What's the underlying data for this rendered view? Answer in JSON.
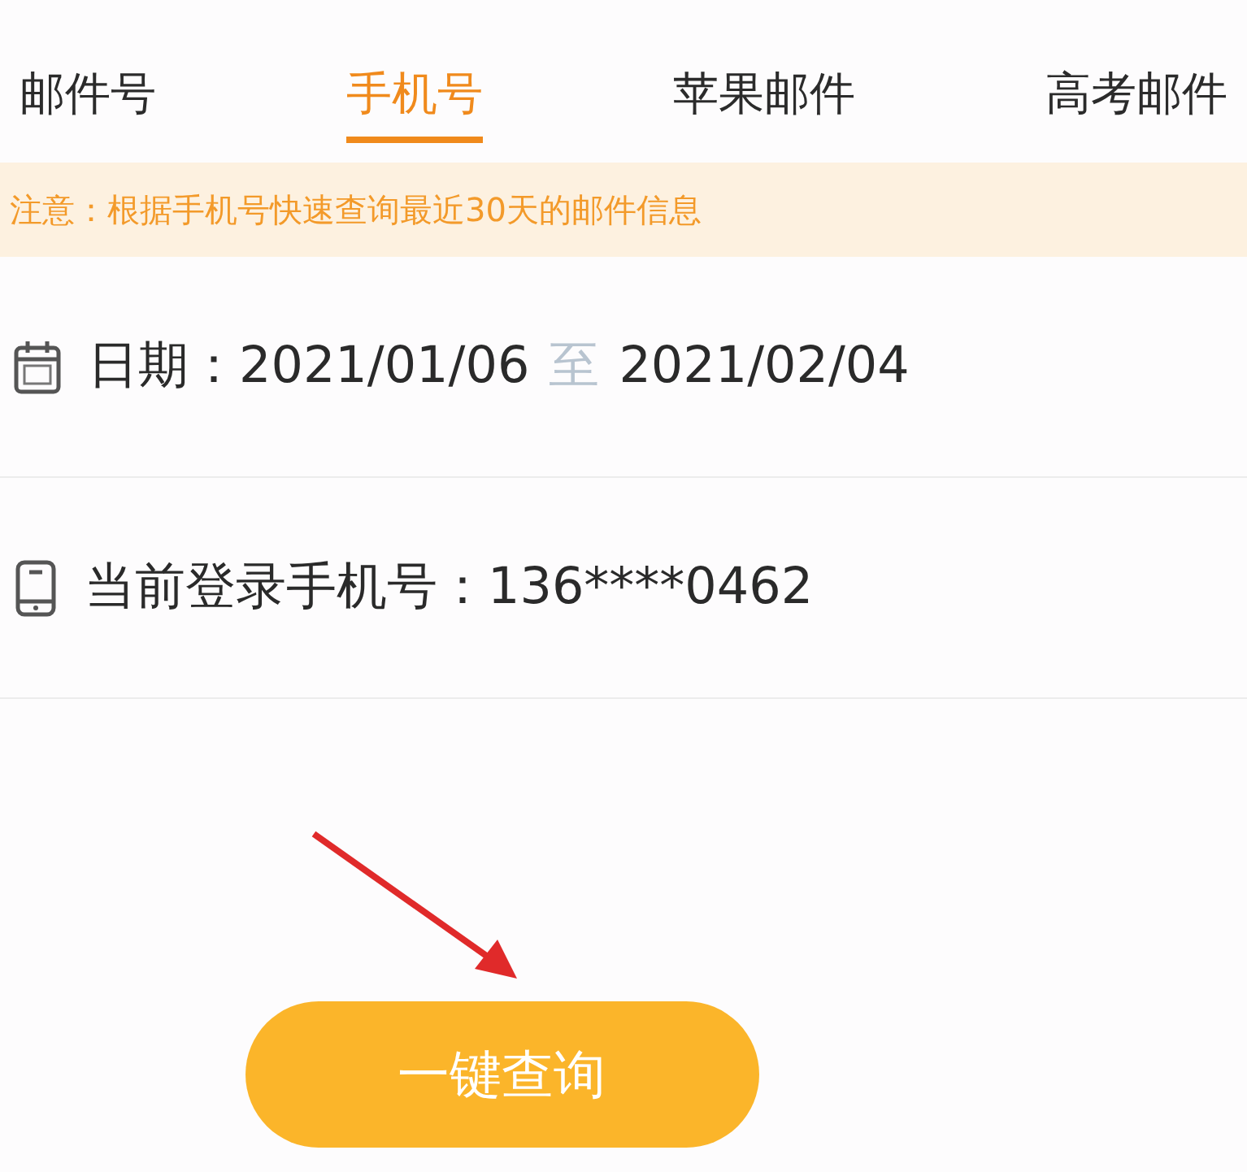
{
  "tabs": [
    {
      "label": "邮件号",
      "selected": false
    },
    {
      "label": "手机号",
      "selected": true
    },
    {
      "label": "苹果邮件",
      "selected": false
    },
    {
      "label": "高考邮件",
      "selected": false
    }
  ],
  "notice": "注意：根据手机号快速查询最近30天的邮件信息",
  "fields": [
    {
      "kind": "date",
      "label": "日期：",
      "from": "2021/01/06",
      "separator": "至",
      "to": "2021/02/04"
    },
    {
      "kind": "phone",
      "label": "当前登录手机号：",
      "value": "136****0462"
    }
  ],
  "button": "一键查询"
}
